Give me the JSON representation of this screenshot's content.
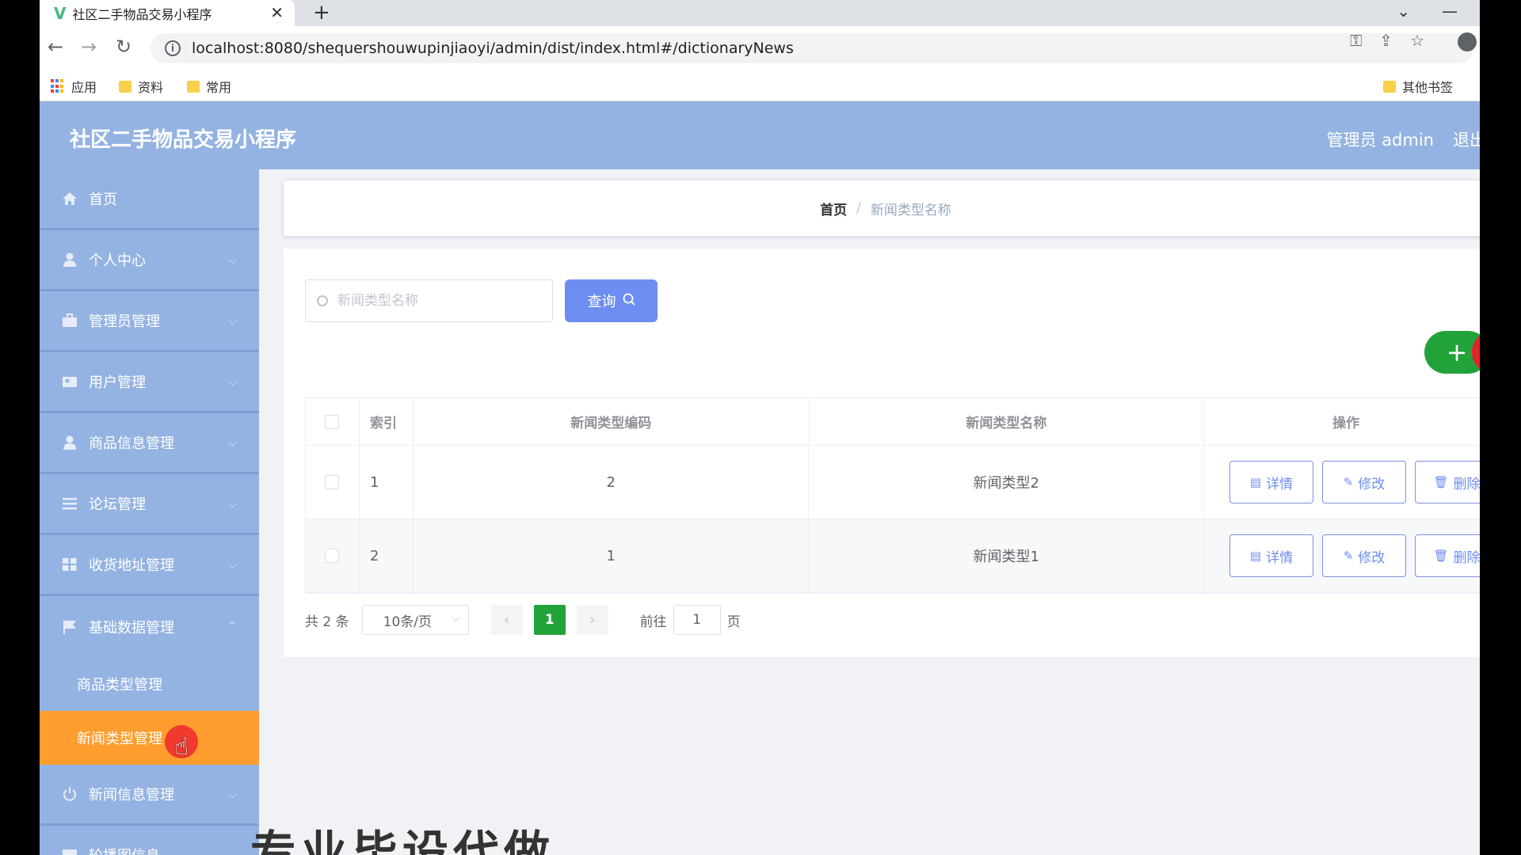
{
  "browser": {
    "tab_title": "社区二手物品交易小程序",
    "tab_close": "✕",
    "new_tab": "+",
    "url": "localhost:8080/shequershouwupinjiaoyi/admin/dist/index.html#/dictionaryNews",
    "bookmarks": {
      "apps": "应用",
      "folder1": "资料",
      "folder2": "常用",
      "other": "其他书签"
    }
  },
  "header": {
    "title": "社区二手物品交易小程序",
    "user": "管理员 admin",
    "logout": "退出"
  },
  "sidebar": {
    "items": [
      {
        "label": "首页",
        "icon": "home-icon"
      },
      {
        "label": "个人中心",
        "icon": "user-icon"
      },
      {
        "label": "管理员管理",
        "icon": "briefcase-icon"
      },
      {
        "label": "用户管理",
        "icon": "users-icon"
      },
      {
        "label": "商品信息管理",
        "icon": "user-icon"
      },
      {
        "label": "论坛管理",
        "icon": "list-icon"
      },
      {
        "label": "收货地址管理",
        "icon": "grid-icon"
      },
      {
        "label": "基础数据管理",
        "icon": "flag-icon"
      }
    ],
    "sub_items": [
      {
        "label": "商品类型管理"
      },
      {
        "label": "新闻类型管理"
      }
    ],
    "after_items": [
      {
        "label": "新闻信息管理",
        "icon": "power-icon"
      },
      {
        "label": "轮播图信息",
        "icon": "image-icon"
      }
    ]
  },
  "breadcrumb": {
    "home": "首页",
    "separator": "/",
    "current": "新闻类型名称"
  },
  "search": {
    "placeholder": "新闻类型名称",
    "button": "查询"
  },
  "actions": {
    "add": "+",
    "delete": "🗑"
  },
  "table": {
    "columns": [
      "索引",
      "新闻类型编码",
      "新闻类型名称",
      "操作"
    ],
    "rows": [
      {
        "index": "1",
        "code": "2",
        "name": "新闻类型2"
      },
      {
        "index": "2",
        "code": "1",
        "name": "新闻类型1"
      }
    ],
    "op_detail": "详情",
    "op_edit": "修改",
    "op_delete": "删除"
  },
  "pagination": {
    "total": "共 2 条",
    "page_size": "10条/页",
    "current_page": "1",
    "goto_label": "前往",
    "goto_value": "1",
    "page_unit": "页"
  },
  "overlay": {
    "watermark": "专业毕设代做"
  },
  "colors": {
    "header_bg": "#94b3e2",
    "active_menu": "#ff9d2e",
    "primary": "#6d8ef0",
    "success": "#22a33a",
    "danger": "#e3242b"
  }
}
